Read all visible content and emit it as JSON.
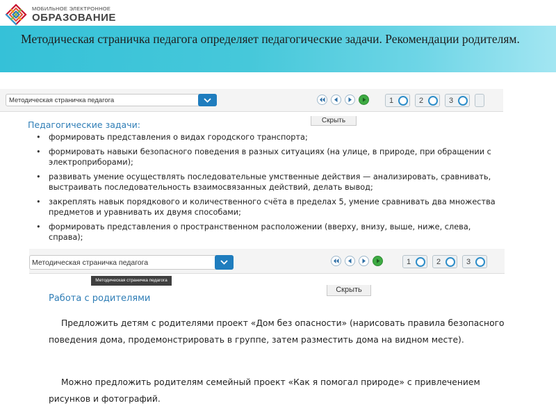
{
  "logo": {
    "line1": "МОБИЛЬНОЕ ЭЛЕКТРОННОЕ",
    "line2": "ОБРАЗОВАНИЕ",
    "icon": "lattice-logo-icon"
  },
  "banner": {
    "title": "Методическая страничка педагога определяет педагогические задачи. Рекомендации родителям."
  },
  "panel1": {
    "select_value": "Методическая страничка педагога",
    "nav_icons": [
      "rewind-icon",
      "back-icon",
      "forward-icon",
      "play-icon"
    ],
    "pages": [
      "1",
      "2",
      "3"
    ],
    "hide_label": "Скрыть",
    "heading": "Педагогические задачи:",
    "tasks": [
      "формировать представления о видах городского транспорта;",
      "формировать навыки безопасного поведения в разных ситуациях (на улице, в природе, при обращении с электроприборами);",
      "развивать умение осуществлять последовательные умственные действия — анализировать, сравнивать, выстраивать последовательность взаимосвязанных действий, делать вывод;",
      "закреплять навык порядкового и количественного счёта в пределах 5, умение сравнивать два множества предметов и уравнивать их двумя способами;",
      "формировать представления о пространственном расположении (вверху, внизу, выше, ниже, слева, справа);"
    ]
  },
  "panel2": {
    "select_value": "Методическая страничка педагога",
    "tooltip": "Методическая страничка педагога",
    "pages": [
      "1",
      "2",
      "3"
    ],
    "hide_label": "Скрыть",
    "heading": "Работа с родителями",
    "paragraph1": "Предложить детям с родителями проект «Дом без опасности» (нарисовать правила безопасного поведения дома, продемонстрировать в группе, затем разместить дома на видном месте).",
    "paragraph2": "Можно предложить родителям семейный проект «Как я помогал природе» с привлечением рисунков и фотографий."
  },
  "colors": {
    "banner_start": "#35c1d8",
    "banner_end": "#a3e6f2",
    "heading_blue": "#2e7db6",
    "select_button": "#1f7dbe",
    "play_green": "#3eab43"
  }
}
